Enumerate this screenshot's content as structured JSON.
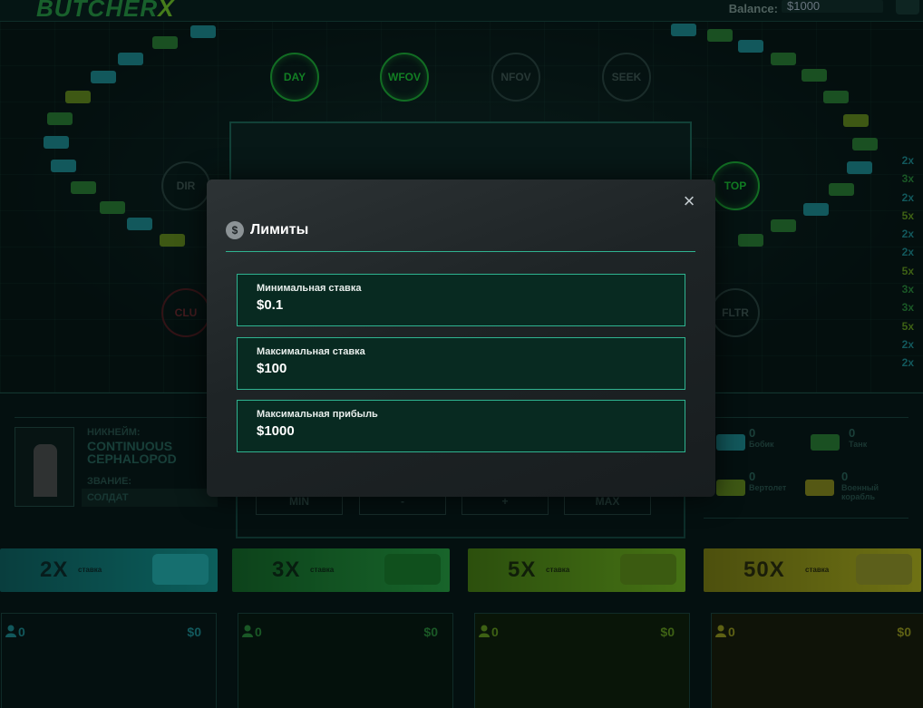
{
  "header": {
    "logo_main": "BUTCHER",
    "logo_x": "X",
    "balance_label": "Balance:",
    "balance_value": "$1000"
  },
  "field": {
    "mode_buttons": [
      "DAY",
      "WFOV",
      "NFOV",
      "SEEK",
      "DIR",
      "TOP",
      "CLU",
      "FLTR"
    ],
    "multiplier_history": [
      "2x",
      "3x",
      "2x",
      "5x",
      "2x",
      "2x",
      "5x",
      "3x",
      "3x",
      "5x",
      "2x",
      "2x"
    ]
  },
  "player": {
    "nickname_label": "НИКНЕЙМ:",
    "nickname": "CONTINUOUS CEPHALOPOD",
    "rank_label": "ЗВАНИЕ:",
    "rank": "СОЛДАТ"
  },
  "controls": {
    "min": "MIN",
    "minus": "-",
    "plus": "+",
    "max": "MAX"
  },
  "stats": [
    {
      "count": "0",
      "label": "Бобик",
      "color": "#1f9aa0"
    },
    {
      "count": "0",
      "label": "Танк",
      "color": "#2e8a38"
    },
    {
      "count": "0",
      "label": "Вертолет",
      "color": "#6f9a1e"
    },
    {
      "count": "0",
      "label": "Военный корабль",
      "color": "#9a9a1e"
    }
  ],
  "bets": [
    {
      "multiplier": "2X",
      "stake_label": "ставка",
      "players": "0",
      "amount": "$0",
      "color": "#1f9aa0"
    },
    {
      "multiplier": "3X",
      "stake_label": "ставка",
      "players": "0",
      "amount": "$0",
      "color": "#2e9a3e"
    },
    {
      "multiplier": "5X",
      "stake_label": "ставка",
      "players": "0",
      "amount": "$0",
      "color": "#6faa1e"
    },
    {
      "multiplier": "50X",
      "stake_label": "ставка",
      "players": "0",
      "amount": "$0",
      "color": "#aaaa1e"
    }
  ],
  "modal": {
    "title": "Лимиты",
    "icon": "dollar-icon",
    "close_label": "×",
    "limits": [
      {
        "label": "Минимальная ставка",
        "value": "$0.1"
      },
      {
        "label": "Максимальная ставка",
        "value": "$100"
      },
      {
        "label": "Максимальная прибыль",
        "value": "$1000"
      }
    ],
    "accent_color": "#2fb390"
  }
}
